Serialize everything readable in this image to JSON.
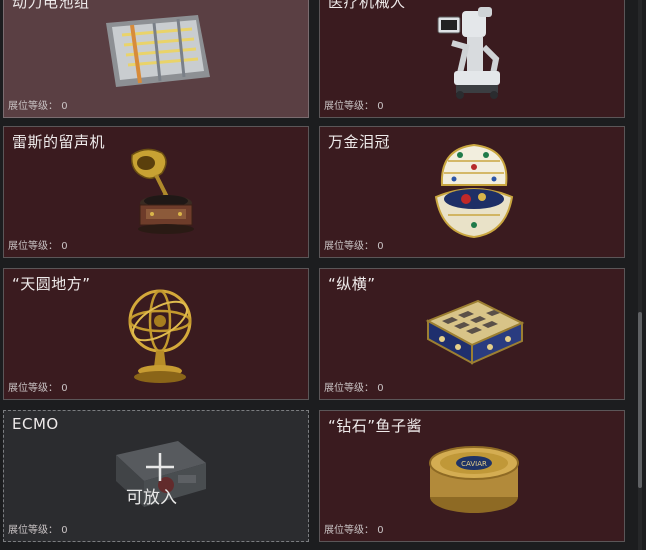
{
  "cards": [
    {
      "name": "动力电池组",
      "level_label": "展位等级：",
      "level": "0",
      "state": "filled"
    },
    {
      "name": "医疗机械人",
      "level_label": "展位等级：",
      "level": "0",
      "state": "filled"
    },
    {
      "name": "雷斯的留声机",
      "level_label": "展位等级：",
      "level": "0",
      "state": "filled"
    },
    {
      "name": "万金泪冠",
      "level_label": "展位等级：",
      "level": "0",
      "state": "filled"
    },
    {
      "name": "“天圆地方”",
      "level_label": "展位等级：",
      "level": "0",
      "state": "filled"
    },
    {
      "name": "“纵横”",
      "level_label": "展位等级：",
      "level": "0",
      "state": "filled"
    },
    {
      "name": "ECMO",
      "level_label": "展位等级：",
      "level": "0",
      "state": "empty",
      "placeholder": "可放入"
    },
    {
      "name": "“钻石”鱼子酱",
      "level_label": "展位等级：",
      "level": "0",
      "state": "filled"
    }
  ],
  "icons": [
    "battery-pack-icon",
    "medical-robot-icon",
    "gramophone-icon",
    "jeweled-egg-icon",
    "armillary-sphere-icon",
    "chess-box-icon",
    "ecmo-machine-icon",
    "caviar-tin-icon"
  ],
  "colors": {
    "card_bg": "#3a1b1f",
    "highlight_bg": "#5a3f43",
    "empty_bg": "#2b2c2f",
    "page_bg": "#1c1d1f"
  }
}
